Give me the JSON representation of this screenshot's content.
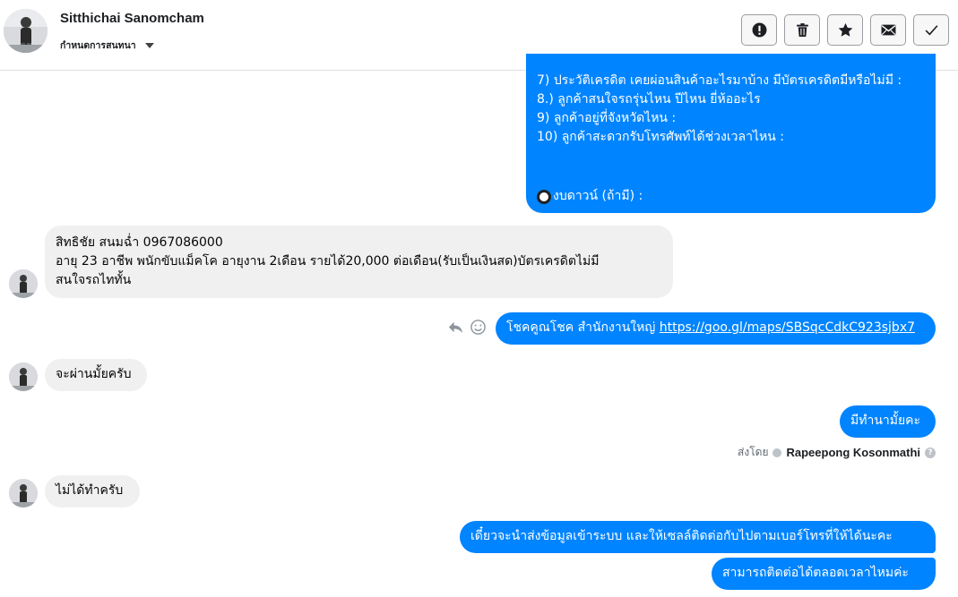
{
  "header": {
    "contact_name": "Sitthichai Sanomcham",
    "status_label": "กำหนดการสนทนา",
    "avatar_icon": "user-photo-avatar",
    "actions": [
      {
        "name": "report-button",
        "icon": "exclamation-icon"
      },
      {
        "name": "delete-button",
        "icon": "trash-icon"
      },
      {
        "name": "star-button",
        "icon": "star-icon"
      },
      {
        "name": "mark-unread-button",
        "icon": "envelope-icon"
      },
      {
        "name": "mark-done-button",
        "icon": "check-icon"
      }
    ]
  },
  "messages": {
    "m1": {
      "lines": [
        "7) ประวัติเครดิต  เคยผ่อนสินค้าอะไรมาบ้าง  มีบัตรเครดิตมีหรือไม่มี :",
        "8.) ลูกค้าสนใจรถรุ่นไหน  ปีไหน  ยี่ห้ออะไร",
        "9)  ลูกค้าอยู่ที่จังหวัดไหน :",
        "10)  ลูกค้าสะดวกรับโทรศัพท์ได้ช่วงเวลาไหน :"
      ],
      "last_line": "งบดาวน์ (ถ้ามี) :"
    },
    "m2": {
      "lines": [
        "สิทธิชัย สนมฉ่ำ 0967086000",
        "อายุ 23 อาชีพ พนักขับแม็คโค อายุงาน 2เดือน รายได้20,000 ต่อเดือน(รับเป็นเงินสด)บัตรเครดิตไม่มี",
        "สนใจรถไททั้น"
      ]
    },
    "m3": {
      "text": "โชคคูณโชค สำนักงานใหญ่ ",
      "link": "https://goo.gl/maps/SBSqcCdkC923sjbx7"
    },
    "m4": {
      "text": "จะผ่านมั้ยครับ"
    },
    "m5": {
      "text": "มีทำนามั้ยคะ"
    },
    "sent_by_label": "ส่งโดย",
    "sent_by_name": "Rapeepong Kosonmathi",
    "m6": {
      "text": "ไม่ได้ทำครับ"
    },
    "m7": {
      "text": "เดี๋ยวจะนำส่งข้อมูลเข้าระบบ และให้เซลล์ติดต่อกับไปตามเบอร์โทรที่ให้ได้นะคะ"
    },
    "m8": {
      "text": "สามารถติดต่อได้ตลอดเวลาไหมค่ะ"
    }
  },
  "colors": {
    "outgoing": "#0084ff",
    "incoming": "#f0f0f0"
  }
}
